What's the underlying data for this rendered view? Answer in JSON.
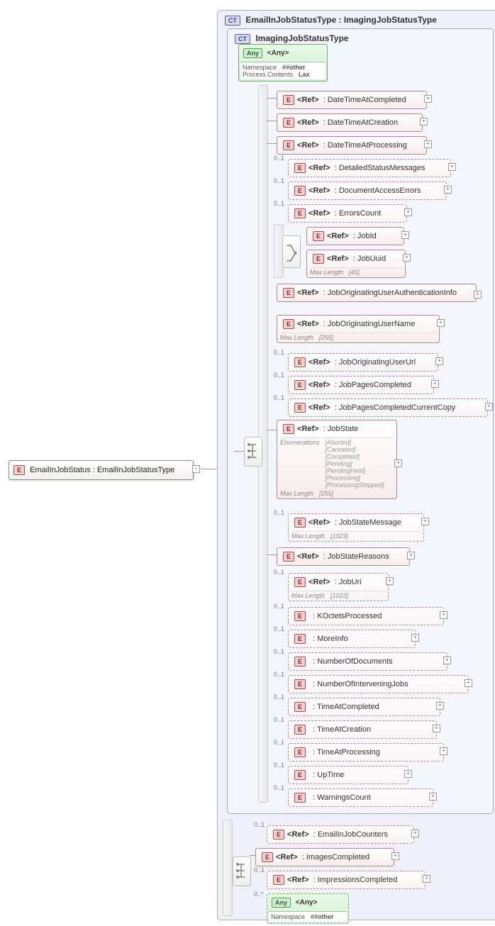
{
  "root": {
    "label": "EmailInJobStatus : EmailInJobStatusType"
  },
  "outer_ct": {
    "title": "EmailInJobStatusType : ImagingJobStatusType",
    "badge": "CT"
  },
  "inner_ct": {
    "title": "ImagingJobStatusType",
    "badge": "CT"
  },
  "any_top": {
    "title": "<Any>",
    "namespace_k": "Namespace",
    "namespace_v": "##other",
    "pc_k": "Process Contents",
    "pc_v": "Lax"
  },
  "refs": [
    {
      "name": ": DateTimeAtCompleted",
      "dashed": false
    },
    {
      "name": ": DateTimeAtCreation",
      "dashed": false
    },
    {
      "name": ": DateTimeAtProcessing",
      "dashed": false
    },
    {
      "name": ": DetailedStatusMessages",
      "dashed": true,
      "occ": "0..1"
    },
    {
      "name": ": DocumentAccessErrors",
      "dashed": true,
      "occ": "0..1"
    },
    {
      "name": ": ErrorsCount",
      "dashed": true,
      "occ": "0..1"
    }
  ],
  "jobid_group": [
    {
      "name": ": JobId"
    },
    {
      "name": ": JobUuid",
      "maxlen_k": "Max Length",
      "maxlen_v": "[45]"
    }
  ],
  "job_auth": {
    "name": ": JobOriginatingUserAuthenticationInfo"
  },
  "job_user": {
    "name": ": JobOriginatingUserName",
    "maxlen_k": "Max Length",
    "maxlen_v": "[255]"
  },
  "mid_refs": [
    {
      "name": ": JobOriginatingUserUrl",
      "occ": "0..1"
    },
    {
      "name": ": JobPagesCompleted",
      "occ": "0..1"
    },
    {
      "name": ": JobPagesCompletedCurrentCopy",
      "occ": "0..1"
    }
  ],
  "jobstate": {
    "name": ": JobState",
    "enum_k": "Enumerations",
    "enums": [
      "[Aborted]",
      "[Canceled]",
      "[Completed]",
      "[Pending]",
      "[PendingHeld]",
      "[Processing]",
      "[ProcessingStopped]"
    ],
    "maxlen_k": "Max Length",
    "maxlen_v": "[255]"
  },
  "statemsg": {
    "name": ": JobStateMessage",
    "occ": "0..1",
    "maxlen_k": "Max Length",
    "maxlen_v": "[1023]"
  },
  "statereasons": {
    "name": ": JobStateReasons"
  },
  "joburi": {
    "name": ": JobUri",
    "occ": "0..1",
    "maxlen_k": "Max Length",
    "maxlen_v": "[1023]"
  },
  "tail_refs": [
    {
      "name": ": KOctetsProcessed",
      "occ": "0..1"
    },
    {
      "name": ": MoreInfo",
      "occ": "0..1"
    },
    {
      "name": ": NumberOfDocuments",
      "occ": "0..1"
    },
    {
      "name": ": NumberOfInterveningJobs",
      "occ": "0..1"
    },
    {
      "name": ": TimeAtCompleted",
      "occ": "0..1"
    },
    {
      "name": ": TimeAtCreation",
      "occ": "0..1"
    },
    {
      "name": ": TimeAtProcessing",
      "occ": "0..1"
    },
    {
      "name": ": UpTime",
      "occ": "0..1"
    },
    {
      "name": ": WarningsCount",
      "occ": "0..1"
    }
  ],
  "outer_seq": [
    {
      "name": ": EmailInJobCounters",
      "occ": "0..1",
      "dashed": true
    },
    {
      "name": ": ImagesCompleted",
      "dashed": false
    },
    {
      "name": ": ImpressionsCompleted",
      "occ": "0..1",
      "dashed": true
    }
  ],
  "any_bot": {
    "title": "<Any>",
    "occ": "0..*",
    "namespace_k": "Namespace",
    "namespace_v": "##other"
  },
  "ref_badge": "<Ref>",
  "e_badge": "E",
  "any_badge": "Any"
}
